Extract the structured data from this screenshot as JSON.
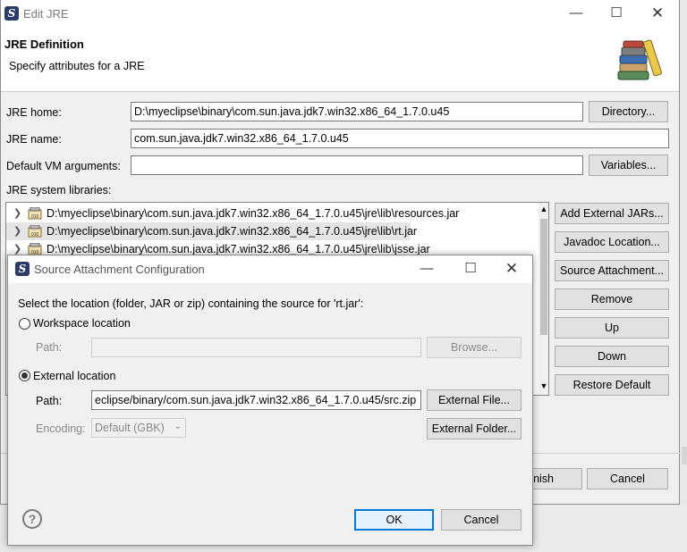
{
  "main_window": {
    "title": "Edit JRE",
    "header_title": "JRE Definition",
    "header_subtitle": "Specify attributes for a JRE",
    "jre_home_label": "JRE home:",
    "jre_home_value": "D:\\myeclipse\\binary\\com.sun.java.jdk7.win32.x86_64_1.7.0.u45",
    "directory_button": "Directory...",
    "jre_name_label": "JRE name:",
    "jre_name_value": "com.sun.java.jdk7.win32.x86_64_1.7.0.u45",
    "vm_args_label": "Default VM arguments:",
    "vm_args_value": "",
    "variables_button": "Variables...",
    "libraries_label": "JRE system libraries:",
    "libraries": [
      {
        "path": "D:\\myeclipse\\binary\\com.sun.java.jdk7.win32.x86_64_1.7.0.u45\\jre\\lib\\resources.jar"
      },
      {
        "path": "D:\\myeclipse\\binary\\com.sun.java.jdk7.win32.x86_64_1.7.0.u45\\jre\\lib\\rt.jar"
      },
      {
        "path": "D:\\myeclipse\\binary\\com.sun.java.jdk7.win32.x86_64_1.7.0.u45\\jre\\lib\\jsse.jar"
      }
    ],
    "side_buttons": {
      "add_external_jars": "Add External JARs...",
      "javadoc_location": "Javadoc Location...",
      "source_attachment": "Source Attachment...",
      "remove": "Remove",
      "up": "Up",
      "down": "Down",
      "restore_default": "Restore Default"
    },
    "finish_button": "nish",
    "cancel_button": "Cancel"
  },
  "dialog": {
    "title": "Source Attachment Configuration",
    "prompt": "Select the location (folder, JAR or zip) containing the source for 'rt.jar':",
    "workspace_option": "Workspace location",
    "workspace_path_label": "Path:",
    "workspace_path_value": "",
    "browse_button": "Browse...",
    "external_option": "External location",
    "external_path_label": "Path:",
    "external_path_value": "eclipse/binary/com.sun.java.jdk7.win32.x86_64_1.7.0.u45/src.zip",
    "external_file_button": "External File...",
    "encoding_label": "Encoding:",
    "encoding_value": "Default (GBK)",
    "external_folder_button": "External Folder...",
    "ok_button": "OK",
    "cancel_button": "Cancel",
    "help_icon": "?",
    "selected_option": "external"
  },
  "icons": {
    "app": "eclipse-app-icon",
    "header": "books-icon",
    "jar": "jar-icon",
    "help": "help-icon"
  }
}
